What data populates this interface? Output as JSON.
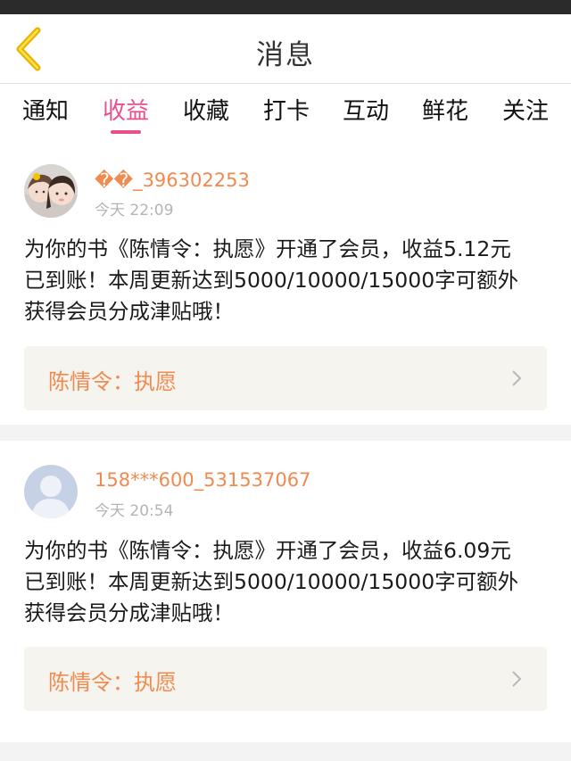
{
  "header": {
    "title": "消息"
  },
  "tabs": [
    {
      "label": "通知",
      "active": false
    },
    {
      "label": "收益",
      "active": true
    },
    {
      "label": "收藏",
      "active": false
    },
    {
      "label": "打卡",
      "active": false
    },
    {
      "label": "互动",
      "active": false
    },
    {
      "label": "鲜花",
      "active": false
    },
    {
      "label": "关注",
      "active": false
    }
  ],
  "messages": [
    {
      "username": "��_396302253",
      "time": "今天 22:09",
      "line1": "为你的书《陈情令：执愿》开通了会员，收益5.12元",
      "line2": "已到账！本周更新达到5000/10000/15000字可额外",
      "line3": "获得会员分成津贴哦！",
      "book": "陈情令：执愿",
      "avatar": "photo-avatar-icon"
    },
    {
      "username": "158***600_531537067",
      "time": "今天 20:54",
      "line1": "为你的书《陈情令：执愿》开通了会员，收益6.09元",
      "line2": "已到账！本周更新达到5000/10000/15000字可额外",
      "line3": "获得会员分成津贴哦！",
      "book": "陈情令：执愿",
      "avatar": "default-avatar-icon"
    }
  ],
  "colors": {
    "accent": "#e94f8e",
    "username": "#f08a4f",
    "time": "#b4b4b4",
    "book_bg": "#f5f4ef",
    "back_arrow": "#e8b400"
  }
}
